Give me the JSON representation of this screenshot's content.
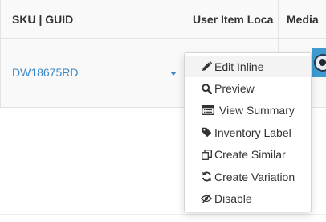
{
  "table": {
    "columns": [
      {
        "label": "SKU | GUID"
      },
      {
        "label": "User Item Loca"
      },
      {
        "label": "Media"
      }
    ],
    "rows": [
      {
        "sku": "DW18675RD",
        "thumbnail_icon": "camera-lens-image"
      }
    ]
  },
  "menu": {
    "items": [
      {
        "label": "Edit Inline",
        "icon": "pencil-icon"
      },
      {
        "label": "Preview",
        "icon": "search-icon"
      },
      {
        "label": "View Summary",
        "icon": "list-box-icon"
      },
      {
        "label": "Inventory Label",
        "icon": "tag-icon"
      },
      {
        "label": "Create Similar",
        "icon": "copy-icon"
      },
      {
        "label": "Create Variation",
        "icon": "refresh-icon"
      },
      {
        "label": "Disable",
        "icon": "eye-slash-icon"
      }
    ]
  },
  "colors": {
    "link": "#3a87c5",
    "text": "#333333",
    "row_background": "#f9f9f9",
    "border": "#e3e3e3"
  }
}
